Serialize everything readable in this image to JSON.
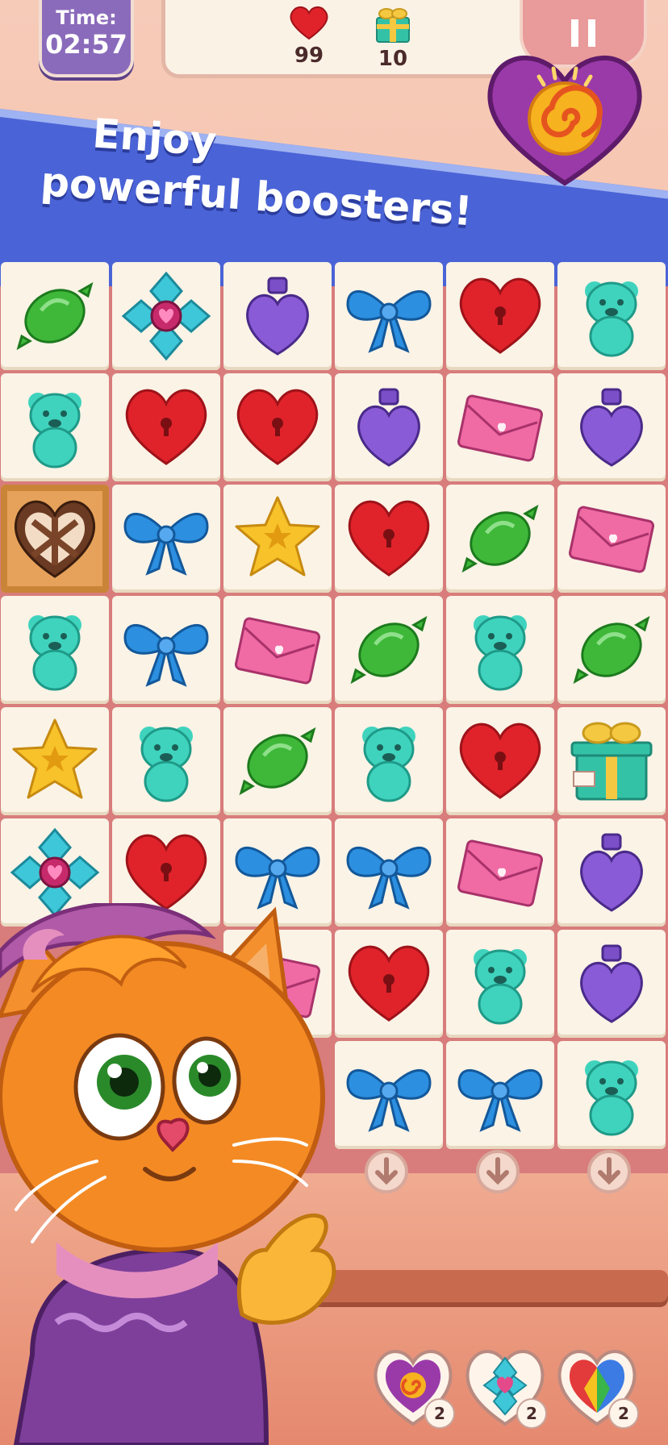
{
  "hud": {
    "timer_label": "Time:",
    "timer_value": "02:57",
    "goals": [
      {
        "icon": "heart-icon",
        "count": "99"
      },
      {
        "icon": "gift-icon",
        "count": "10"
      }
    ],
    "pause_icon": "pause-icon"
  },
  "banner": {
    "line1": "Enjoy",
    "line2": "powerful boosters!",
    "booster_icon": "swirl-heart-booster"
  },
  "board": {
    "columns": 6,
    "rows": [
      [
        "candy",
        "gem",
        "potion",
        "bow",
        "heart",
        "bear"
      ],
      [
        "bear",
        "heart",
        "heart",
        "potion",
        "envelope",
        "potion"
      ],
      [
        "choco",
        "bow",
        "star",
        "heart",
        "candy",
        "envelope"
      ],
      [
        "bear",
        "bow",
        "envelope",
        "candy",
        "bear",
        "candy"
      ],
      [
        "star",
        "bear",
        "candy",
        "bear",
        "heart",
        "gift"
      ],
      [
        "gem",
        "heart",
        "bow",
        "bow",
        "envelope",
        "potion"
      ],
      [
        "",
        "",
        "envelope",
        "heart",
        "bear",
        "potion"
      ],
      [
        "",
        "",
        "",
        "bow",
        "bow",
        "bear"
      ]
    ],
    "drop_arrows": [
      "arrow-down-icon",
      "arrow-down-icon",
      "arrow-down-icon"
    ]
  },
  "boosters": [
    {
      "icon": "swirl-heart-booster",
      "count": "2"
    },
    {
      "icon": "gem-heart-booster",
      "count": "2"
    },
    {
      "icon": "rainbow-heart-booster",
      "count": "2"
    }
  ],
  "colors": {
    "banner": "#4a63d6",
    "timer": "#8a6bbb",
    "board": "#d87c7c",
    "tile": "#faf3e6"
  }
}
